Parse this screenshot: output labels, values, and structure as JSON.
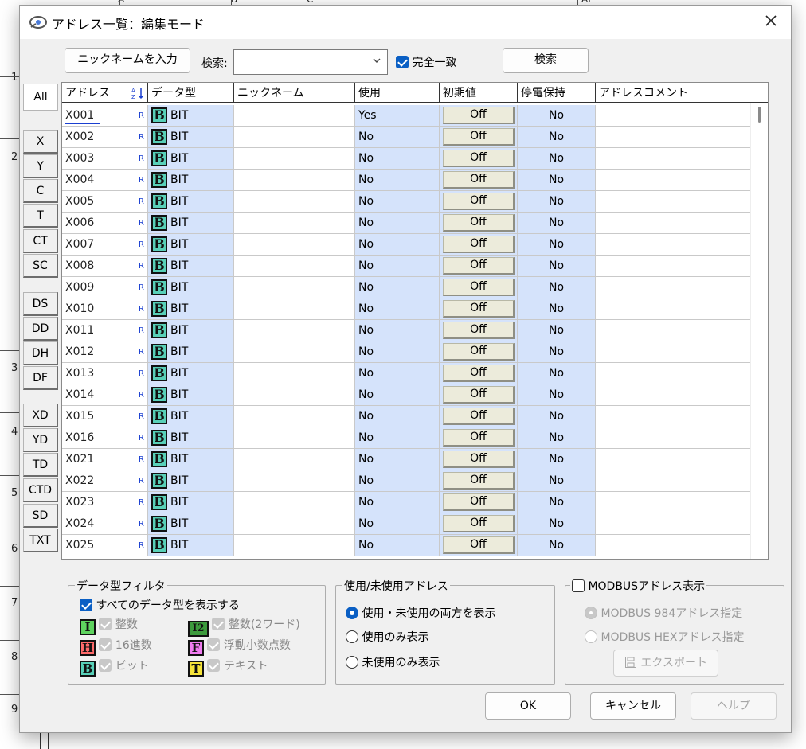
{
  "window": {
    "title": "アドレス一覧：編集モード"
  },
  "toolbar": {
    "nickname_button": "ニックネームを入力",
    "search_label": "検索:",
    "search_value": "",
    "exact_match_label": "完全一致",
    "search_button": "検索"
  },
  "categories": [
    "All",
    "X",
    "Y",
    "C",
    "T",
    "CT",
    "SC",
    "DS",
    "DD",
    "DH",
    "DF",
    "XD",
    "YD",
    "TD",
    "CTD",
    "SD",
    "TXT"
  ],
  "columns": [
    "アドレス",
    "データ型",
    "ニックネーム",
    "使用",
    "初期値",
    "停電保持",
    "アドレスコメント"
  ],
  "rows": [
    {
      "address": "X001",
      "type": "BIT",
      "type_letter": "B",
      "nickname": "",
      "used": "Yes",
      "initial": "Off",
      "retentive": "No",
      "comment": ""
    },
    {
      "address": "X002",
      "type": "BIT",
      "type_letter": "B",
      "nickname": "",
      "used": "No",
      "initial": "Off",
      "retentive": "No",
      "comment": ""
    },
    {
      "address": "X003",
      "type": "BIT",
      "type_letter": "B",
      "nickname": "",
      "used": "No",
      "initial": "Off",
      "retentive": "No",
      "comment": ""
    },
    {
      "address": "X004",
      "type": "BIT",
      "type_letter": "B",
      "nickname": "",
      "used": "No",
      "initial": "Off",
      "retentive": "No",
      "comment": ""
    },
    {
      "address": "X005",
      "type": "BIT",
      "type_letter": "B",
      "nickname": "",
      "used": "No",
      "initial": "Off",
      "retentive": "No",
      "comment": ""
    },
    {
      "address": "X006",
      "type": "BIT",
      "type_letter": "B",
      "nickname": "",
      "used": "No",
      "initial": "Off",
      "retentive": "No",
      "comment": ""
    },
    {
      "address": "X007",
      "type": "BIT",
      "type_letter": "B",
      "nickname": "",
      "used": "No",
      "initial": "Off",
      "retentive": "No",
      "comment": ""
    },
    {
      "address": "X008",
      "type": "BIT",
      "type_letter": "B",
      "nickname": "",
      "used": "No",
      "initial": "Off",
      "retentive": "No",
      "comment": ""
    },
    {
      "address": "X009",
      "type": "BIT",
      "type_letter": "B",
      "nickname": "",
      "used": "No",
      "initial": "Off",
      "retentive": "No",
      "comment": ""
    },
    {
      "address": "X010",
      "type": "BIT",
      "type_letter": "B",
      "nickname": "",
      "used": "No",
      "initial": "Off",
      "retentive": "No",
      "comment": ""
    },
    {
      "address": "X011",
      "type": "BIT",
      "type_letter": "B",
      "nickname": "",
      "used": "No",
      "initial": "Off",
      "retentive": "No",
      "comment": ""
    },
    {
      "address": "X012",
      "type": "BIT",
      "type_letter": "B",
      "nickname": "",
      "used": "No",
      "initial": "Off",
      "retentive": "No",
      "comment": ""
    },
    {
      "address": "X013",
      "type": "BIT",
      "type_letter": "B",
      "nickname": "",
      "used": "No",
      "initial": "Off",
      "retentive": "No",
      "comment": ""
    },
    {
      "address": "X014",
      "type": "BIT",
      "type_letter": "B",
      "nickname": "",
      "used": "No",
      "initial": "Off",
      "retentive": "No",
      "comment": ""
    },
    {
      "address": "X015",
      "type": "BIT",
      "type_letter": "B",
      "nickname": "",
      "used": "No",
      "initial": "Off",
      "retentive": "No",
      "comment": ""
    },
    {
      "address": "X016",
      "type": "BIT",
      "type_letter": "B",
      "nickname": "",
      "used": "No",
      "initial": "Off",
      "retentive": "No",
      "comment": ""
    },
    {
      "address": "X021",
      "type": "BIT",
      "type_letter": "B",
      "nickname": "",
      "used": "No",
      "initial": "Off",
      "retentive": "No",
      "comment": ""
    },
    {
      "address": "X022",
      "type": "BIT",
      "type_letter": "B",
      "nickname": "",
      "used": "No",
      "initial": "Off",
      "retentive": "No",
      "comment": ""
    },
    {
      "address": "X023",
      "type": "BIT",
      "type_letter": "B",
      "nickname": "",
      "used": "No",
      "initial": "Off",
      "retentive": "No",
      "comment": ""
    },
    {
      "address": "X024",
      "type": "BIT",
      "type_letter": "B",
      "nickname": "",
      "used": "No",
      "initial": "Off",
      "retentive": "No",
      "comment": ""
    },
    {
      "address": "X025",
      "type": "BIT",
      "type_letter": "B",
      "nickname": "",
      "used": "No",
      "initial": "Off",
      "retentive": "No",
      "comment": ""
    }
  ],
  "r_mark": "R",
  "type_filter": {
    "title": "データ型フィルタ",
    "show_all_label": "すべてのデータ型を表示する",
    "items": [
      {
        "letter": "I",
        "label": "整数",
        "color": "#5fd35f"
      },
      {
        "letter": "I2",
        "label": "整数(2ワード)",
        "color": "#3c9a3c"
      },
      {
        "letter": "H",
        "label": "16進数",
        "color": "#ff6b6b"
      },
      {
        "letter": "F",
        "label": "浮動小数点数",
        "color": "#f07cf0"
      },
      {
        "letter": "B",
        "label": "ビット",
        "color": "#58d0b8"
      },
      {
        "letter": "T",
        "label": "テキスト",
        "color": "#f5e33a"
      }
    ]
  },
  "usage_filter": {
    "title": "使用/未使用アドレス",
    "options": [
      "使用・未使用の両方を表示",
      "使用のみ表示",
      "未使用のみ表示"
    ],
    "selected": 0
  },
  "modbus": {
    "title": "MODBUSアドレス表示",
    "options": [
      "MODBUS 984アドレス指定",
      "MODBUS HEXアドレス指定"
    ],
    "export_label": "エクスポート"
  },
  "footer": {
    "ok": "OK",
    "cancel": "キャンセル",
    "help": "ヘルプ"
  },
  "background": {
    "row_numbers": [
      "1",
      "2",
      "3",
      "4",
      "5",
      "6",
      "7",
      "8",
      "9"
    ],
    "col_headers": [
      "A",
      "B",
      "C",
      "AE"
    ]
  }
}
